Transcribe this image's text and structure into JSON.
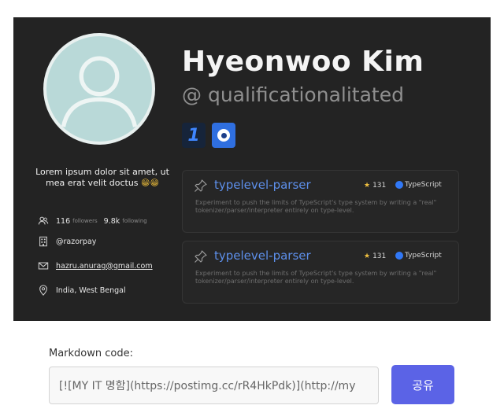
{
  "profile": {
    "name": "Hyeonwoo Kim",
    "handle": "@ qualificationalitated",
    "bio": "Lorem ipsum dolor sit amet, ut mea erat velit doctus",
    "bio_emoji": "😁😁",
    "followers_count": "116",
    "followers_label": "followers",
    "following_count": "9.8k",
    "following_label": "following",
    "company": "@razorpay",
    "email": "hazru.anurag@gmail.com",
    "location": "India, West Bengal"
  },
  "badges": [
    {
      "icon": "one-badge-icon",
      "text": "1"
    },
    {
      "icon": "circle-badge-icon"
    }
  ],
  "repos": [
    {
      "title": "typelevel-parser",
      "stars": "131",
      "language": "TypeScript",
      "description": "Experiment to push the limits of TypeScript's type system by writing a \"real\" tokenizer/parser/interpreter entirely on type-level."
    },
    {
      "title": "typelevel-parser",
      "stars": "131",
      "language": "TypeScript",
      "description": "Experiment to push the limits of TypeScript's type system by writing a \"real\" tokenizer/parser/interpreter entirely on type-level."
    }
  ],
  "markdown": {
    "label": "Markdown code:",
    "value": "[![MY IT 명함](https://postimg.cc/rR4HkPdk)](http://my"
  },
  "share_label": "공유",
  "colors": {
    "card_bg": "#232323",
    "repo_title": "#5d8fea",
    "typescript": "#3178f6",
    "share_button": "#5b63e6"
  }
}
